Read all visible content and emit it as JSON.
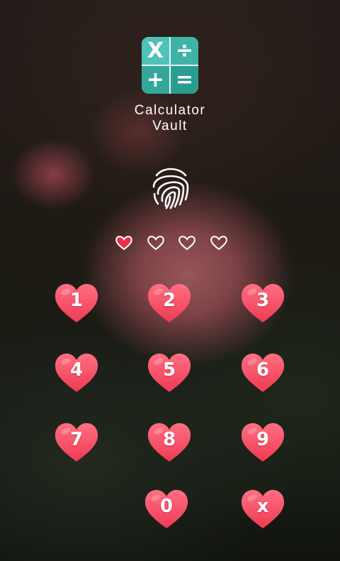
{
  "app": {
    "title_line1": "Calculator",
    "title_line2": "Vault",
    "logo_symbols": [
      "X",
      "÷",
      "+",
      "="
    ]
  },
  "pin": {
    "length": 4,
    "filled": 1
  },
  "keypad": {
    "keys": [
      "1",
      "2",
      "3",
      "4",
      "5",
      "6",
      "7",
      "8",
      "9",
      "0",
      "x"
    ]
  },
  "colors": {
    "heart_key": "#ef3a53",
    "heart_key_light": "#ff6f82",
    "logo_teal": "#3fb3a8",
    "dot_filled": "#ee2f4c",
    "dot_empty": "#ffffff"
  },
  "icons": {
    "fingerprint": "fingerprint-icon",
    "pin_dot": "heart-outline-icon",
    "key_shape": "heart-icon"
  }
}
